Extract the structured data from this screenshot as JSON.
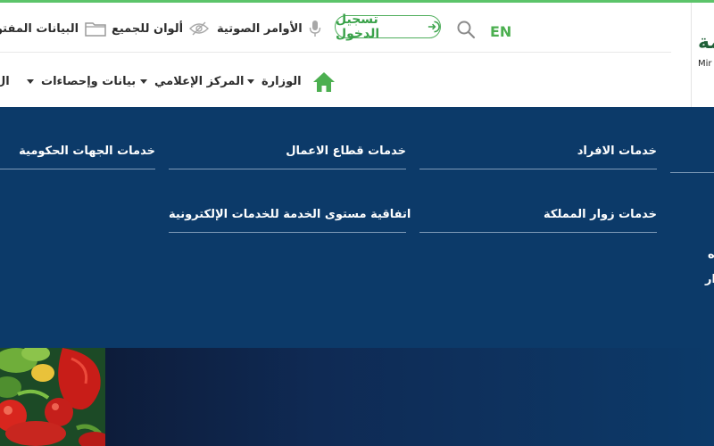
{
  "utility_bar": {
    "open_data": "البيانات المفتو",
    "colors_for_all": "ألوان للجميع",
    "voice_commands": "الأوامر الصوتية",
    "login": "تسجيل الدخول",
    "language": "EN"
  },
  "logo": {
    "arabic": "مة",
    "english": "Mir"
  },
  "nav": {
    "ministry": "الوزارة",
    "media_center": "المركز الإعلامي",
    "data_stats": "بيانات وإحصاءات",
    "fragment": "ال"
  },
  "services": {
    "individuals": "خدمات الافراد",
    "business": "خدمات قطاع الاعمال",
    "government": "خدمات الجهات الحكومية",
    "visitors": "خدمات زوار المملكة",
    "sla": "اتفاقية مستوى الخدمة للخدمات الإلكترونية"
  },
  "side_text": {
    "line1": "ه",
    "line2": "ار"
  },
  "colors": {
    "accent_green": "#4caf50",
    "panel_navy": "#0c3a69",
    "header_bg": "#ffffff"
  },
  "icons": {
    "folder": "folder-icon",
    "eye_slash": "eye-slash-icon",
    "microphone": "microphone-icon",
    "login": "login-icon",
    "search": "search-icon",
    "home": "home-icon"
  }
}
